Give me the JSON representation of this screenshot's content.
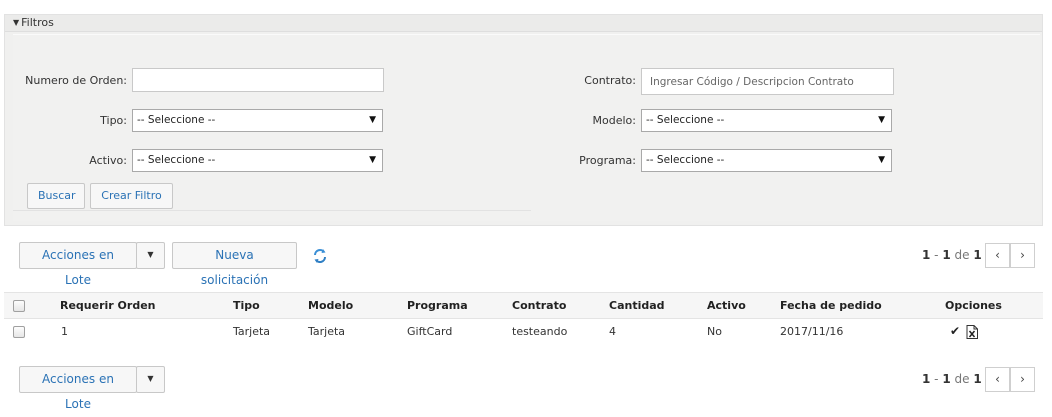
{
  "filters": {
    "header": "Filtros",
    "orden_label": "Numero de Orden:",
    "orden_value": "",
    "tipo_label": "Tipo:",
    "tipo_value": "-- Seleccione --",
    "activo_label": "Activo:",
    "activo_value": "-- Seleccione --",
    "contrato_label": "Contrato:",
    "contrato_placeholder": "Ingresar Código / Descripcion Contrato",
    "modelo_label": "Modelo:",
    "modelo_value": "-- Seleccione --",
    "programa_label": "Programa:",
    "programa_value": "-- Seleccione --",
    "buscar": "Buscar",
    "crear_filtro": "Crear Filtro"
  },
  "toolbar": {
    "acciones_lote": "Acciones en Lote",
    "nueva_solicitacion": "Nueva solicitación"
  },
  "pager": {
    "start": "1",
    "end": "1",
    "sep": " - ",
    "of": " de ",
    "total": "1",
    "prev": "‹",
    "next": "›"
  },
  "table": {
    "headers": {
      "requerir": "Requerir Orden",
      "tipo": "Tipo",
      "modelo": "Modelo",
      "programa": "Programa",
      "contrato": "Contrato",
      "cantidad": "Cantidad",
      "activo": "Activo",
      "fecha": "Fecha de pedido",
      "opciones": "Opciones"
    },
    "rows": [
      {
        "requerir": "1",
        "tipo": "Tarjeta",
        "modelo": "Tarjeta",
        "programa": "GiftCard",
        "contrato": "testeando",
        "cantidad": "4",
        "activo": "No",
        "fecha": "2017/11/16",
        "options_icons": [
          "check-icon",
          "excel-export-icon"
        ]
      }
    ]
  },
  "colors": {
    "link_blue": "#2a72b5",
    "panel_bg": "#f0f0ef",
    "header_bg": "#f6f6f6"
  }
}
